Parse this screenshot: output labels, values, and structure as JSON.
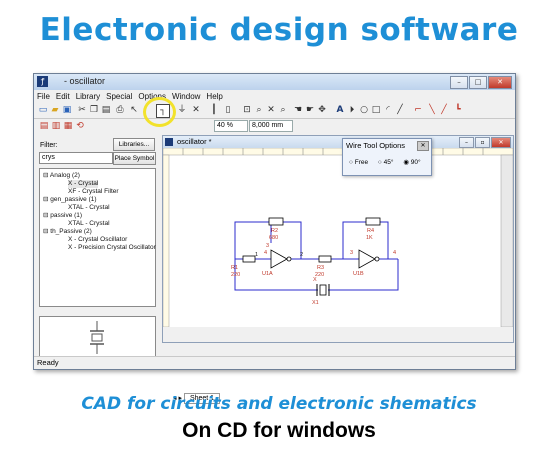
{
  "headline": "Electronic design software",
  "tagline_line1": "CAD for circuits and electronic shematics",
  "tagline_line2": "On CD for windows",
  "app": {
    "title": "- oscillator",
    "menus": [
      "File",
      "Edit",
      "Library",
      "Special",
      "Options",
      "Window",
      "Help"
    ],
    "zoom": "40 %",
    "grid": "8,000 mm",
    "status": "Ready",
    "accent": "#1e8fd6"
  },
  "library_panel": {
    "filter_label": "Filter:",
    "filter_value": "crys",
    "libraries_button": "Libraries...",
    "place_button": "Place Symbol",
    "tree": [
      {
        "label": "Analog (2)",
        "level": 0
      },
      {
        "label": "X - Crystal",
        "level": 2,
        "selected": true
      },
      {
        "label": "XF - Crystal Filter",
        "level": 2
      },
      {
        "label": "gen_passive (1)",
        "level": 0
      },
      {
        "label": "XTAL - Crystal",
        "level": 2
      },
      {
        "label": "passive (1)",
        "level": 0
      },
      {
        "label": "XTAL - Crystal",
        "level": 2
      },
      {
        "label": "th_Passive (2)",
        "level": 0
      },
      {
        "label": "X - Crystal Oscillator",
        "level": 2
      },
      {
        "label": "X - Precision Crystal Oscillator",
        "level": 2
      }
    ]
  },
  "schematic_window": {
    "title": "oscillator *",
    "sheet_tab": "Sheet 1",
    "labels": {
      "r2": "R2",
      "r2v": "680",
      "r4": "R4",
      "r4v": "1K",
      "r1": "R1",
      "r1v": "220",
      "r3": "R3",
      "r3v": "220",
      "u1a": "U1A",
      "u1b": "U1B",
      "x": "X",
      "x1": "X1",
      "n3a": "3",
      "n4a": "4",
      "n1": "1",
      "n2": "2",
      "n3b": "3",
      "n4b": "4"
    }
  },
  "wire_tool_options": {
    "title": "Wire Tool Options",
    "options": [
      "Free",
      "45°",
      "90°"
    ],
    "selected": "90°"
  }
}
